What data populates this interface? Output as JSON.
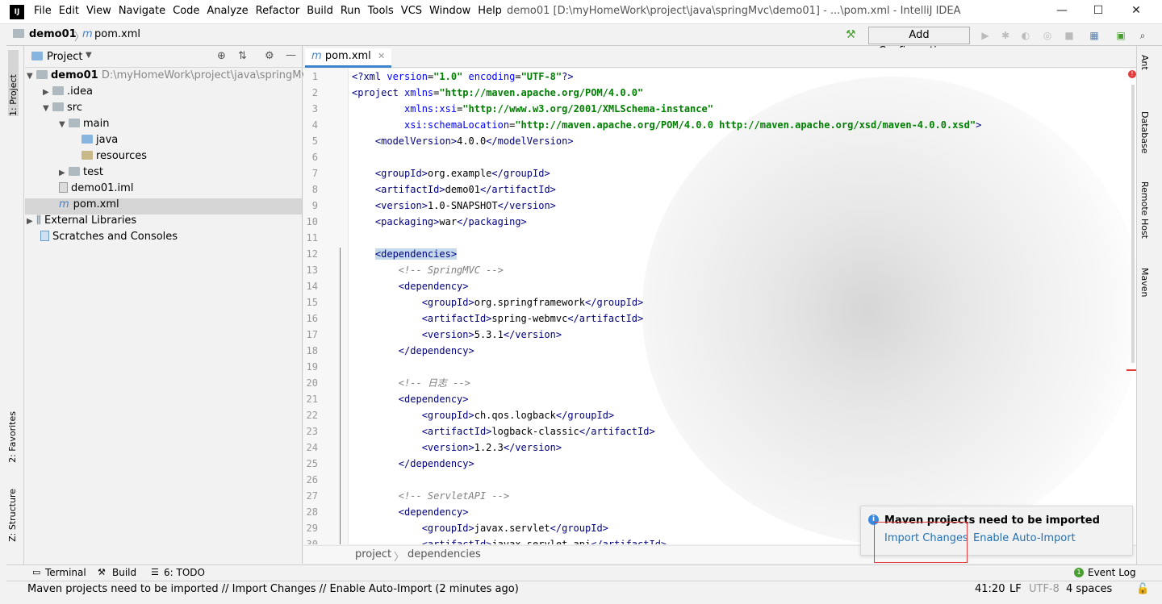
{
  "menubar": {
    "logo": "IJ",
    "items": [
      "File",
      "Edit",
      "View",
      "Navigate",
      "Code",
      "Analyze",
      "Refactor",
      "Build",
      "Run",
      "Tools",
      "VCS",
      "Window",
      "Help"
    ],
    "title": "demo01 [D:\\myHomeWork\\project\\java\\springMvc\\demo01] - ...\\pom.xml - IntelliJ IDEA",
    "minimize": "—",
    "maximize": "☐",
    "close": "✕"
  },
  "navbar": {
    "project": "demo01",
    "file": "pom.xml",
    "add_configuration": "Add Configuration..."
  },
  "left_tabs": {
    "project": "1: Project",
    "favorites": "2: Favorites",
    "structure": "Z: Structure"
  },
  "right_tabs": {
    "ant": "Ant",
    "database": "Database",
    "remote_host": "Remote Host",
    "maven": "Maven"
  },
  "project_panel": {
    "title": "Project",
    "tree": [
      {
        "label": "demo01",
        "extra": "D:\\myHomeWork\\project\\java\\springMvc\\d"
      },
      {
        "label": ".idea"
      },
      {
        "label": "src"
      },
      {
        "label": "main"
      },
      {
        "label": "java"
      },
      {
        "label": "resources"
      },
      {
        "label": "test"
      },
      {
        "label": "demo01.iml"
      },
      {
        "label": "pom.xml"
      },
      {
        "label": "External Libraries"
      },
      {
        "label": "Scratches and Consoles"
      }
    ]
  },
  "editor": {
    "tab": "pom.xml",
    "lines": [
      "1",
      "2",
      "3",
      "4",
      "5",
      "6",
      "7",
      "8",
      "9",
      "10",
      "11",
      "12",
      "13",
      "14",
      "15",
      "16",
      "17",
      "18",
      "19",
      "20",
      "21",
      "22",
      "23",
      "24",
      "25",
      "26",
      "27",
      "28",
      "29",
      "30"
    ],
    "breadcrumb": [
      "project",
      "dependencies"
    ]
  },
  "bottom_tools": {
    "terminal": "Terminal",
    "build": "Build",
    "todo": "6: TODO",
    "event_log": "Event Log"
  },
  "status": {
    "message": "Maven projects need to be imported // Import Changes // Enable Auto-Import (2 minutes ago)",
    "position": "41:20",
    "line_sep": "LF",
    "encoding": "UTF-8",
    "indent": "4 spaces"
  },
  "notification": {
    "title": "Maven projects need to be imported",
    "import_changes": "Import Changes",
    "enable_auto_import": "Enable Auto-Import"
  },
  "colors": {
    "accent": "#4083c9",
    "link": "#2470b3",
    "highlight": "#e23b3b"
  }
}
